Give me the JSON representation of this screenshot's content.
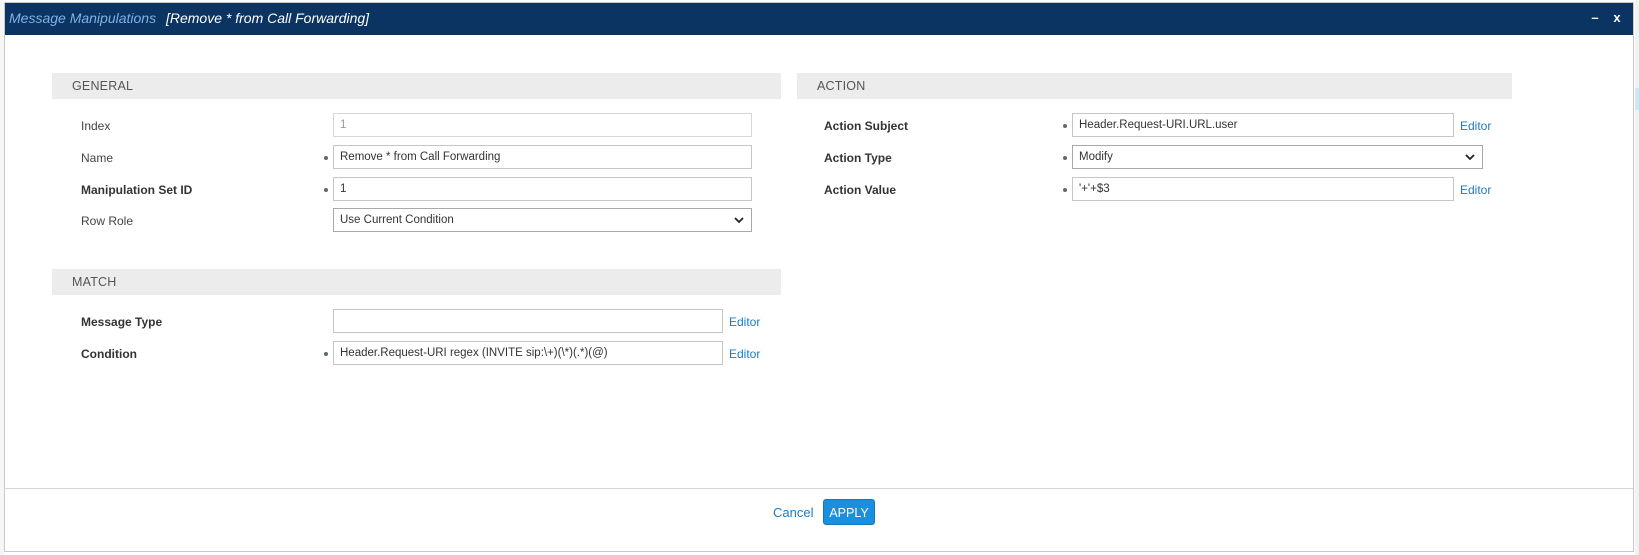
{
  "title": {
    "module": "Message Manipulations",
    "item": "[Remove * from Call Forwarding]",
    "minimize": "–",
    "close": "x"
  },
  "general": {
    "header": "GENERAL",
    "index": {
      "label": "Index",
      "value": "1"
    },
    "name": {
      "label": "Name",
      "value": "Remove * from Call Forwarding"
    },
    "manipulation_set_id": {
      "label": "Manipulation Set ID",
      "value": "1"
    },
    "row_role": {
      "label": "Row Role",
      "value": "Use Current Condition"
    }
  },
  "match": {
    "header": "MATCH",
    "message_type": {
      "label": "Message Type",
      "value": "",
      "editor": "Editor"
    },
    "condition": {
      "label": "Condition",
      "value": "Header.Request-URI regex (INVITE sip:\\+)(\\*)(.*)(@)",
      "editor": "Editor"
    }
  },
  "action": {
    "header": "ACTION",
    "action_subject": {
      "label": "Action Subject",
      "value": "Header.Request-URI.URL.user",
      "editor": "Editor"
    },
    "action_type": {
      "label": "Action Type",
      "value": "Modify"
    },
    "action_value": {
      "label": "Action Value",
      "value": "'+'+$3",
      "editor": "Editor"
    }
  },
  "footer": {
    "cancel": "Cancel",
    "apply": "APPLY"
  },
  "colors": {
    "titlebar": "#0b3462",
    "accent": "#1a8fe0",
    "link": "#1a7bc9"
  }
}
